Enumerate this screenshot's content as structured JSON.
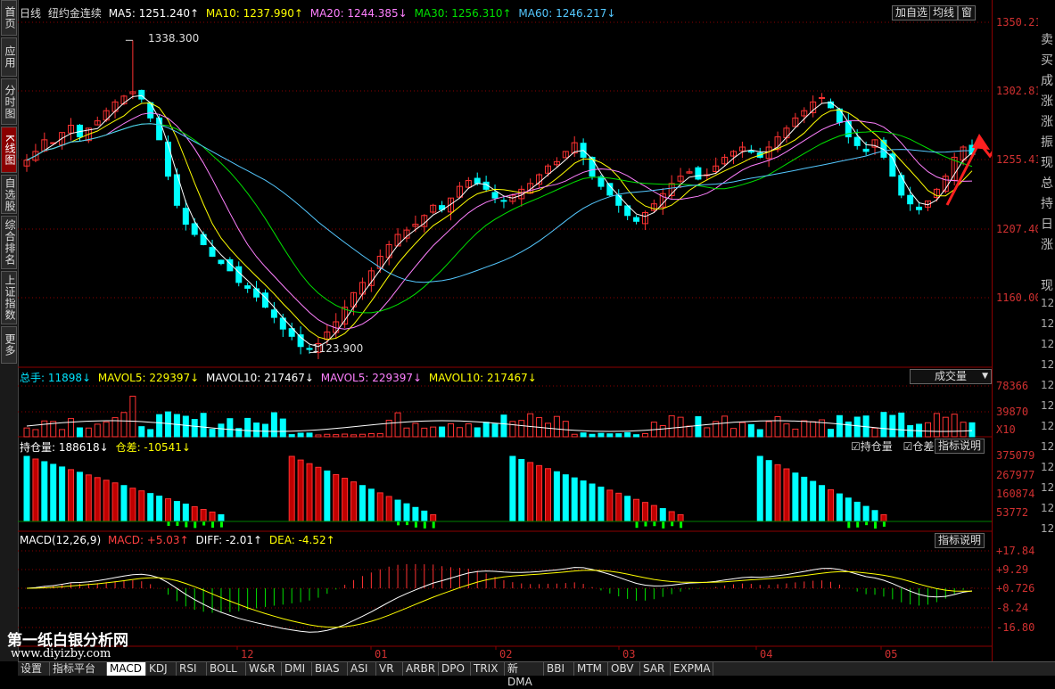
{
  "left_nav": [
    "首页",
    "应用",
    "分时图",
    "K线图",
    "自选股",
    "综合排名",
    "上证指数",
    "更多"
  ],
  "left_nav_active": 3,
  "price_header": {
    "period": "日线",
    "name": "纽约金连续",
    "ma5": "MA5: 1251.240↑",
    "ma10": "MA10: 1237.990↑",
    "ma20": "MA20: 1244.385↓",
    "ma30": "MA30: 1256.310↑",
    "ma60": "MA60: 1246.217↓"
  },
  "top_buttons": [
    "加自选",
    "均线",
    "窗"
  ],
  "price_axis": [
    "1350.211",
    "1302.813",
    "1255.415",
    "1207.401",
    "1160.003"
  ],
  "high_label": "1338.300",
  "low_label": "1123.900",
  "volume_header": {
    "total": "总手: 11898↓",
    "mavol5": "MAVOL5: 229397↓",
    "mavol10": "MAVOL10: 217467↓",
    "mavol5b": "MAVOL5: 229397↓",
    "mavol10b": "MAVOL10: 217467↓"
  },
  "volume_selector": "成交量",
  "volume_axis": [
    "78366",
    "39870",
    "X10"
  ],
  "oi_header": {
    "oi": "持仓量: 188618↓",
    "diff": "仓差: -10541↓"
  },
  "oi_checks": [
    "持仓量",
    "仓差"
  ],
  "oi_help": "指标说明",
  "oi_axis": [
    "375079",
    "267977",
    "160874",
    "53772"
  ],
  "macd_header": {
    "name": "MACD(12,26,9)",
    "macd": "MACD: +5.03↑",
    "diff": "DIFF: -2.01↑",
    "dea": "DEA: -4.52↑"
  },
  "macd_help": "指标说明",
  "macd_axis": [
    "+17.84",
    "+9.29",
    "+0.726",
    "-8.24",
    "-16.80"
  ],
  "x_labels": [
    "12",
    "01",
    "02",
    "03",
    "04",
    "05"
  ],
  "right_panel_chars": [
    "卖",
    "买",
    "成",
    "涨",
    "涨",
    "振",
    "现",
    "总",
    "持",
    "日",
    "涨",
    "",
    "现",
    "12",
    "12",
    "12",
    "12",
    "12",
    "12",
    "12",
    "12",
    "12",
    "12",
    "12",
    "12"
  ],
  "tabs": [
    "设置",
    "指标平台",
    "MACD",
    "KDJ",
    "RSI",
    "BOLL",
    "W&R",
    "DMI",
    "BIAS",
    "ASI",
    "VR",
    "ARBR",
    "DPO",
    "TRIX",
    "新DMA",
    "BBI",
    "MTM",
    "OBV",
    "SAR",
    "EXPMA"
  ],
  "active_tab": 2,
  "watermark_line1": "第一纸白银分析网",
  "watermark_line2": "www.diyizby.com",
  "colors": {
    "up": "#ff3232",
    "down": "#00ffff",
    "ma5": "#ffffff",
    "ma10": "#ffff00",
    "ma20": "#ff80ff",
    "ma30": "#00e000",
    "ma60": "#54c8ff",
    "grid": "#8b0000",
    "arrow": "#ff2020"
  },
  "chart_data": {
    "type": "candlestick",
    "price_range": [
      1115,
      1355
    ],
    "closes": [
      1256,
      1262,
      1270,
      1268,
      1275,
      1280,
      1272,
      1278,
      1283,
      1290,
      1296,
      1300,
      1303,
      1298,
      1285,
      1270,
      1245,
      1225,
      1212,
      1205,
      1198,
      1190,
      1185,
      1180,
      1172,
      1168,
      1162,
      1155,
      1148,
      1140,
      1135,
      1128,
      1126,
      1130,
      1138,
      1145,
      1155,
      1165,
      1172,
      1180,
      1190,
      1198,
      1205,
      1208,
      1212,
      1218,
      1225,
      1222,
      1230,
      1238,
      1242,
      1240,
      1236,
      1230,
      1228,
      1232,
      1236,
      1240,
      1246,
      1252,
      1255,
      1262,
      1268,
      1258,
      1245,
      1238,
      1232,
      1225,
      1218,
      1214,
      1220,
      1226,
      1233,
      1240,
      1245,
      1248,
      1243,
      1246,
      1252,
      1258,
      1262,
      1265,
      1262,
      1258,
      1265,
      1272,
      1278,
      1285,
      1290,
      1296,
      1299,
      1292,
      1282,
      1272,
      1266,
      1262,
      1270,
      1258,
      1245,
      1232,
      1226,
      1222,
      1228,
      1236,
      1245,
      1258,
      1265,
      1260
    ],
    "x_ticks": [
      "12",
      "01",
      "02",
      "03",
      "04",
      "05"
    ],
    "y_ticks": [
      1350.211,
      1302.813,
      1255.415,
      1207.401,
      1160.003
    ],
    "high": 1338.3,
    "low": 1123.9,
    "volume_range_ticks": [
      78366,
      39870
    ],
    "oi_ticks": [
      375079,
      267977,
      160874,
      53772
    ],
    "macd_ticks": [
      17.84,
      9.29,
      0.726,
      -8.24,
      -16.8
    ]
  }
}
